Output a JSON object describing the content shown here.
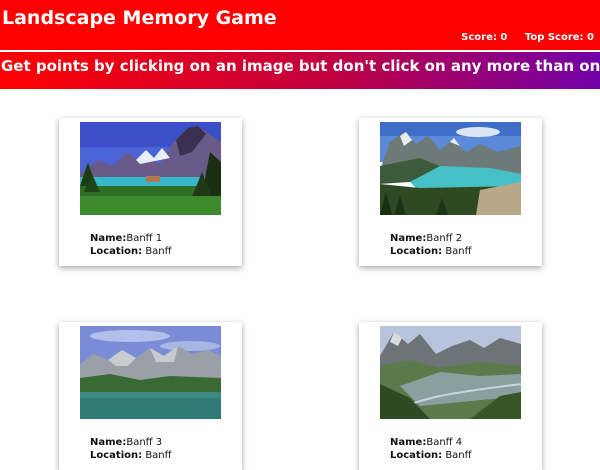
{
  "header": {
    "title": "Landscape Memory Game",
    "score_label": "Score:",
    "score_value": "0",
    "top_score_label": "Top Score:",
    "top_score_value": "0"
  },
  "banner": {
    "instructions": "Get points by clicking on an image but don't click on any more than once!"
  },
  "cards": [
    {
      "name_label": "Name:",
      "name": "Banff 1",
      "location_label": "Location:",
      "location": "Banff",
      "image": "lake-mountain-photo"
    },
    {
      "name_label": "Name:",
      "name": "Banff 2",
      "location_label": "Location:",
      "location": "Banff",
      "image": "turquoise-lake-photo"
    },
    {
      "name_label": "Name:",
      "name": "Banff 3",
      "location_label": "Location:",
      "location": "Banff",
      "image": "mountain-lake-photo"
    },
    {
      "name_label": "Name:",
      "name": "Banff 4",
      "location_label": "Location:",
      "location": "Banff",
      "image": "valley-town-photo"
    }
  ],
  "colors": {
    "navbar": "#ff0000",
    "banner_start": "#ff0000",
    "banner_end": "#7000a8",
    "text_on_header": "#ffffff"
  }
}
